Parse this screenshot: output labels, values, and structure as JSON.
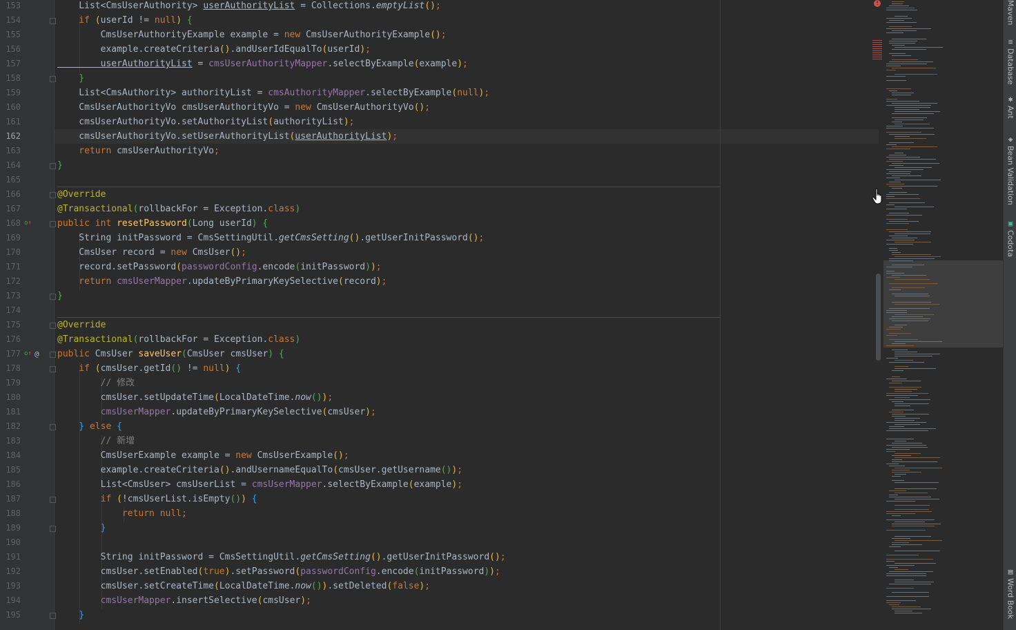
{
  "editor": {
    "current_line": 162,
    "lines": [
      {
        "n": 153,
        "tokens": [
          [
            "",
            "    List<CmsUserAuthority> "
          ],
          [
            "ul",
            "userAuthorityList"
          ],
          [
            "",
            " = Collections."
          ],
          [
            "st",
            "emptyList"
          ],
          [
            "br1",
            "()"
          ],
          [
            "kw",
            ";"
          ]
        ]
      },
      {
        "n": 154,
        "tokens": [
          [
            "kw",
            "    if "
          ],
          [
            "br1",
            "("
          ],
          [
            "",
            "userId != "
          ],
          [
            "kw",
            "null"
          ],
          [
            "br1",
            ")"
          ],
          [
            "br2",
            " {"
          ]
        ]
      },
      {
        "n": 155,
        "tokens": [
          [
            "",
            "        CmsUserAuthorityExample example = "
          ],
          [
            "kw",
            "new "
          ],
          [
            "",
            "CmsUserAuthorityExample"
          ],
          [
            "br1",
            "()"
          ],
          [
            "kw",
            ";"
          ]
        ]
      },
      {
        "n": 156,
        "tokens": [
          [
            "",
            "        example.createCriteria"
          ],
          [
            "br1",
            "()"
          ],
          [
            "",
            ".andUserIdEqualTo"
          ],
          [
            "br1",
            "("
          ],
          [
            "",
            "userId"
          ],
          [
            "br1",
            ")"
          ],
          [
            "kw",
            ";"
          ]
        ]
      },
      {
        "n": 157,
        "tokens": [
          [
            "ul",
            "        userAuthorityList"
          ],
          [
            "",
            " = "
          ],
          [
            "fld",
            "cmsUserAuthorityMapper"
          ],
          [
            "",
            ".selectByExample"
          ],
          [
            "br1",
            "("
          ],
          [
            "",
            "example"
          ],
          [
            "br1",
            ")"
          ],
          [
            "kw",
            ";"
          ]
        ]
      },
      {
        "n": 158,
        "tokens": [
          [
            "br2",
            "    }"
          ]
        ]
      },
      {
        "n": 159,
        "tokens": [
          [
            "",
            "    List<CmsAuthority> authorityList = "
          ],
          [
            "fld",
            "cmsAuthorityMapper"
          ],
          [
            "",
            ".selectByExample"
          ],
          [
            "br1",
            "("
          ],
          [
            "kw",
            "null"
          ],
          [
            "br1",
            ")"
          ],
          [
            "kw",
            ";"
          ]
        ]
      },
      {
        "n": 160,
        "tokens": [
          [
            "",
            "    CmsUserAuthorityVo cmsUserAuthorityVo = "
          ],
          [
            "kw",
            "new "
          ],
          [
            "",
            "CmsUserAuthorityVo"
          ],
          [
            "br1",
            "()"
          ],
          [
            "kw",
            ";"
          ]
        ]
      },
      {
        "n": 161,
        "tokens": [
          [
            "",
            "    cmsUserAuthorityVo.setAuthorityList"
          ],
          [
            "br1",
            "("
          ],
          [
            "",
            "authorityList"
          ],
          [
            "br1",
            ")"
          ],
          [
            "kw",
            ";"
          ]
        ]
      },
      {
        "n": 162,
        "tokens": [
          [
            "",
            "    cmsUserAuthorityVo.setUserAuthorityList"
          ],
          [
            "br1",
            "("
          ],
          [
            "ul",
            "userAuthorityList"
          ],
          [
            "br1",
            ")"
          ],
          [
            "kw",
            ";"
          ]
        ]
      },
      {
        "n": 163,
        "tokens": [
          [
            "kw",
            "    return "
          ],
          [
            "",
            "cmsUserAuthorityVo"
          ],
          [
            "kw",
            ";"
          ]
        ]
      },
      {
        "n": 164,
        "tokens": [
          [
            "br2",
            "}"
          ]
        ]
      },
      {
        "n": 165,
        "tokens": []
      },
      {
        "n": 166,
        "tokens": [
          [
            "an",
            "@Override"
          ]
        ]
      },
      {
        "n": 167,
        "tokens": [
          [
            "an",
            "@Transactional"
          ],
          [
            "br2",
            "("
          ],
          [
            "",
            "rollbackFor = Exception."
          ],
          [
            "kw",
            "class"
          ],
          [
            "br2",
            ")"
          ]
        ]
      },
      {
        "n": 168,
        "tokens": [
          [
            "kw",
            "public int "
          ],
          [
            "fn",
            "resetPassword"
          ],
          [
            "br2",
            "("
          ],
          [
            "",
            "Long userId"
          ],
          [
            "br2",
            ")"
          ],
          [
            "br2",
            " {"
          ]
        ]
      },
      {
        "n": 169,
        "tokens": [
          [
            "",
            "    String initPassword = CmsSettingUtil."
          ],
          [
            "st",
            "getCmsSetting"
          ],
          [
            "br1",
            "()"
          ],
          [
            "",
            ".getUserInitPassword"
          ],
          [
            "br1",
            "()"
          ],
          [
            "kw",
            ";"
          ]
        ]
      },
      {
        "n": 170,
        "tokens": [
          [
            "",
            "    CmsUser record = "
          ],
          [
            "kw",
            "new "
          ],
          [
            "",
            "CmsUser"
          ],
          [
            "br1",
            "()"
          ],
          [
            "kw",
            ";"
          ]
        ]
      },
      {
        "n": 171,
        "tokens": [
          [
            "",
            "    record.setPassword"
          ],
          [
            "br1",
            "("
          ],
          [
            "fld",
            "passwordConfig"
          ],
          [
            "",
            ".encode"
          ],
          [
            "br2",
            "("
          ],
          [
            "",
            "initPassword"
          ],
          [
            "br2",
            ")"
          ],
          [
            "br1",
            ")"
          ],
          [
            "kw",
            ";"
          ]
        ]
      },
      {
        "n": 172,
        "tokens": [
          [
            "kw",
            "    return "
          ],
          [
            "fld",
            "cmsUserMapper"
          ],
          [
            "",
            ".updateByPrimaryKeySelective"
          ],
          [
            "br1",
            "("
          ],
          [
            "",
            "record"
          ],
          [
            "br1",
            ")"
          ],
          [
            "kw",
            ";"
          ]
        ]
      },
      {
        "n": 173,
        "tokens": [
          [
            "br2",
            "}"
          ]
        ]
      },
      {
        "n": 174,
        "tokens": []
      },
      {
        "n": 175,
        "tokens": [
          [
            "an",
            "@Override"
          ]
        ]
      },
      {
        "n": 176,
        "tokens": [
          [
            "an",
            "@Transactional"
          ],
          [
            "br2",
            "("
          ],
          [
            "",
            "rollbackFor = Exception."
          ],
          [
            "kw",
            "class"
          ],
          [
            "br2",
            ")"
          ]
        ]
      },
      {
        "n": 177,
        "tokens": [
          [
            "kw",
            "public "
          ],
          [
            "",
            "CmsUser "
          ],
          [
            "fn",
            "saveUser"
          ],
          [
            "br2",
            "("
          ],
          [
            "",
            "CmsUser cmsUser"
          ],
          [
            "br2",
            ")"
          ],
          [
            "br2",
            " {"
          ]
        ]
      },
      {
        "n": 178,
        "tokens": [
          [
            "kw",
            "    if "
          ],
          [
            "br1",
            "("
          ],
          [
            "",
            "cmsUser.getId"
          ],
          [
            "br2",
            "()"
          ],
          [
            "",
            " != "
          ],
          [
            "kw",
            "null"
          ],
          [
            "br1",
            ")"
          ],
          [
            "br3",
            " {"
          ]
        ]
      },
      {
        "n": 179,
        "tokens": [
          [
            "cm",
            "        // 修改"
          ]
        ]
      },
      {
        "n": 180,
        "tokens": [
          [
            "",
            "        cmsUser.setUpdateTime"
          ],
          [
            "br1",
            "("
          ],
          [
            "",
            "LocalDateTime."
          ],
          [
            "st",
            "now"
          ],
          [
            "br2",
            "()"
          ],
          [
            "br1",
            ")"
          ],
          [
            "kw",
            ";"
          ]
        ]
      },
      {
        "n": 181,
        "tokens": [
          [
            "fld",
            "        cmsUserMapper"
          ],
          [
            "",
            ".updateByPrimaryKeySelective"
          ],
          [
            "br1",
            "("
          ],
          [
            "",
            "cmsUser"
          ],
          [
            "br1",
            ")"
          ],
          [
            "kw",
            ";"
          ]
        ]
      },
      {
        "n": 182,
        "tokens": [
          [
            "br3",
            "    } "
          ],
          [
            "kw",
            "else "
          ],
          [
            "br3",
            "{"
          ]
        ]
      },
      {
        "n": 183,
        "tokens": [
          [
            "cm",
            "        // 新增"
          ]
        ]
      },
      {
        "n": 184,
        "tokens": [
          [
            "",
            "        CmsUserExample example = "
          ],
          [
            "kw",
            "new "
          ],
          [
            "",
            "CmsUserExample"
          ],
          [
            "br1",
            "()"
          ],
          [
            "kw",
            ";"
          ]
        ]
      },
      {
        "n": 185,
        "tokens": [
          [
            "",
            "        example.createCriteria"
          ],
          [
            "br1",
            "()"
          ],
          [
            "",
            ".andUsernameEqualTo"
          ],
          [
            "br1",
            "("
          ],
          [
            "",
            "cmsUser.getUsername"
          ],
          [
            "br2",
            "()"
          ],
          [
            "br1",
            ")"
          ],
          [
            "kw",
            ";"
          ]
        ]
      },
      {
        "n": 186,
        "tokens": [
          [
            "",
            "        List<CmsUser> cmsUserList = "
          ],
          [
            "fld",
            "cmsUserMapper"
          ],
          [
            "",
            ".selectByExample"
          ],
          [
            "br1",
            "("
          ],
          [
            "",
            "example"
          ],
          [
            "br1",
            ")"
          ],
          [
            "kw",
            ";"
          ]
        ]
      },
      {
        "n": 187,
        "tokens": [
          [
            "kw",
            "        if "
          ],
          [
            "br1",
            "("
          ],
          [
            "",
            "!cmsUserList.isEmpty"
          ],
          [
            "br2",
            "()"
          ],
          [
            "br1",
            ")"
          ],
          [
            "br3",
            " {"
          ]
        ]
      },
      {
        "n": 188,
        "tokens": [
          [
            "kw",
            "            return null;"
          ]
        ]
      },
      {
        "n": 189,
        "tokens": [
          [
            "br3",
            "        }"
          ]
        ]
      },
      {
        "n": 190,
        "tokens": []
      },
      {
        "n": 191,
        "tokens": [
          [
            "",
            "        String initPassword = CmsSettingUtil."
          ],
          [
            "st",
            "getCmsSetting"
          ],
          [
            "br1",
            "()"
          ],
          [
            "",
            ".getUserInitPassword"
          ],
          [
            "br1",
            "()"
          ],
          [
            "kw",
            ";"
          ]
        ]
      },
      {
        "n": 192,
        "tokens": [
          [
            "",
            "        cmsUser.setEnabled"
          ],
          [
            "br1",
            "("
          ],
          [
            "kw",
            "true"
          ],
          [
            "br1",
            ")"
          ],
          [
            "",
            ".setPassword"
          ],
          [
            "br1",
            "("
          ],
          [
            "fld",
            "passwordConfig"
          ],
          [
            "",
            ".encode"
          ],
          [
            "br2",
            "("
          ],
          [
            "",
            "initPassword"
          ],
          [
            "br2",
            ")"
          ],
          [
            "br1",
            ")"
          ],
          [
            "kw",
            ";"
          ]
        ]
      },
      {
        "n": 193,
        "tokens": [
          [
            "",
            "        cmsUser.setCreateTime"
          ],
          [
            "br1",
            "("
          ],
          [
            "",
            "LocalDateTime."
          ],
          [
            "st",
            "now"
          ],
          [
            "br2",
            "()"
          ],
          [
            "br1",
            ")"
          ],
          [
            "",
            ".setDeleted"
          ],
          [
            "br1",
            "("
          ],
          [
            "kw",
            "false"
          ],
          [
            "br1",
            ")"
          ],
          [
            "kw",
            ";"
          ]
        ]
      },
      {
        "n": 194,
        "tokens": [
          [
            "fld",
            "        cmsUserMapper"
          ],
          [
            "",
            ".insertSelective"
          ],
          [
            "br1",
            "("
          ],
          [
            "",
            "cmsUser"
          ],
          [
            "br1",
            ")"
          ],
          [
            "kw",
            ";"
          ]
        ]
      },
      {
        "n": 195,
        "tokens": [
          [
            "br3",
            "    }"
          ]
        ]
      }
    ]
  },
  "gutter_icons": [
    {
      "line": 168,
      "icons": [
        "override-up-arrow-icon"
      ]
    },
    {
      "line": 177,
      "icons": [
        "override-up-arrow-icon",
        "at-sign-icon"
      ]
    }
  ],
  "right_toolbar": {
    "tools": [
      {
        "id": "maven",
        "label": "Maven",
        "icon": ""
      },
      {
        "id": "database",
        "label": "Database",
        "icon": "database-icon"
      },
      {
        "id": "ant",
        "label": "Ant",
        "icon": "ant-icon"
      },
      {
        "id": "bean-validation",
        "label": "Bean Validation",
        "icon": "bean-validation-icon"
      },
      {
        "id": "codota",
        "label": "Codota",
        "icon": "codota-icon"
      },
      {
        "id": "word-book",
        "label": "Word Book",
        "icon": "book-icon"
      }
    ]
  },
  "colors": {
    "background": "#2b2b2b",
    "gutter": "#313335",
    "keyword": "#cc7832",
    "annotation": "#bbb529",
    "method": "#ffc66d",
    "field": "#9876aa",
    "comment": "#808080",
    "text": "#a9b7c6",
    "bracket_1": "#e8ba36",
    "bracket_2": "#54a857",
    "bracket_3": "#359ff4",
    "error": "#c75450"
  }
}
